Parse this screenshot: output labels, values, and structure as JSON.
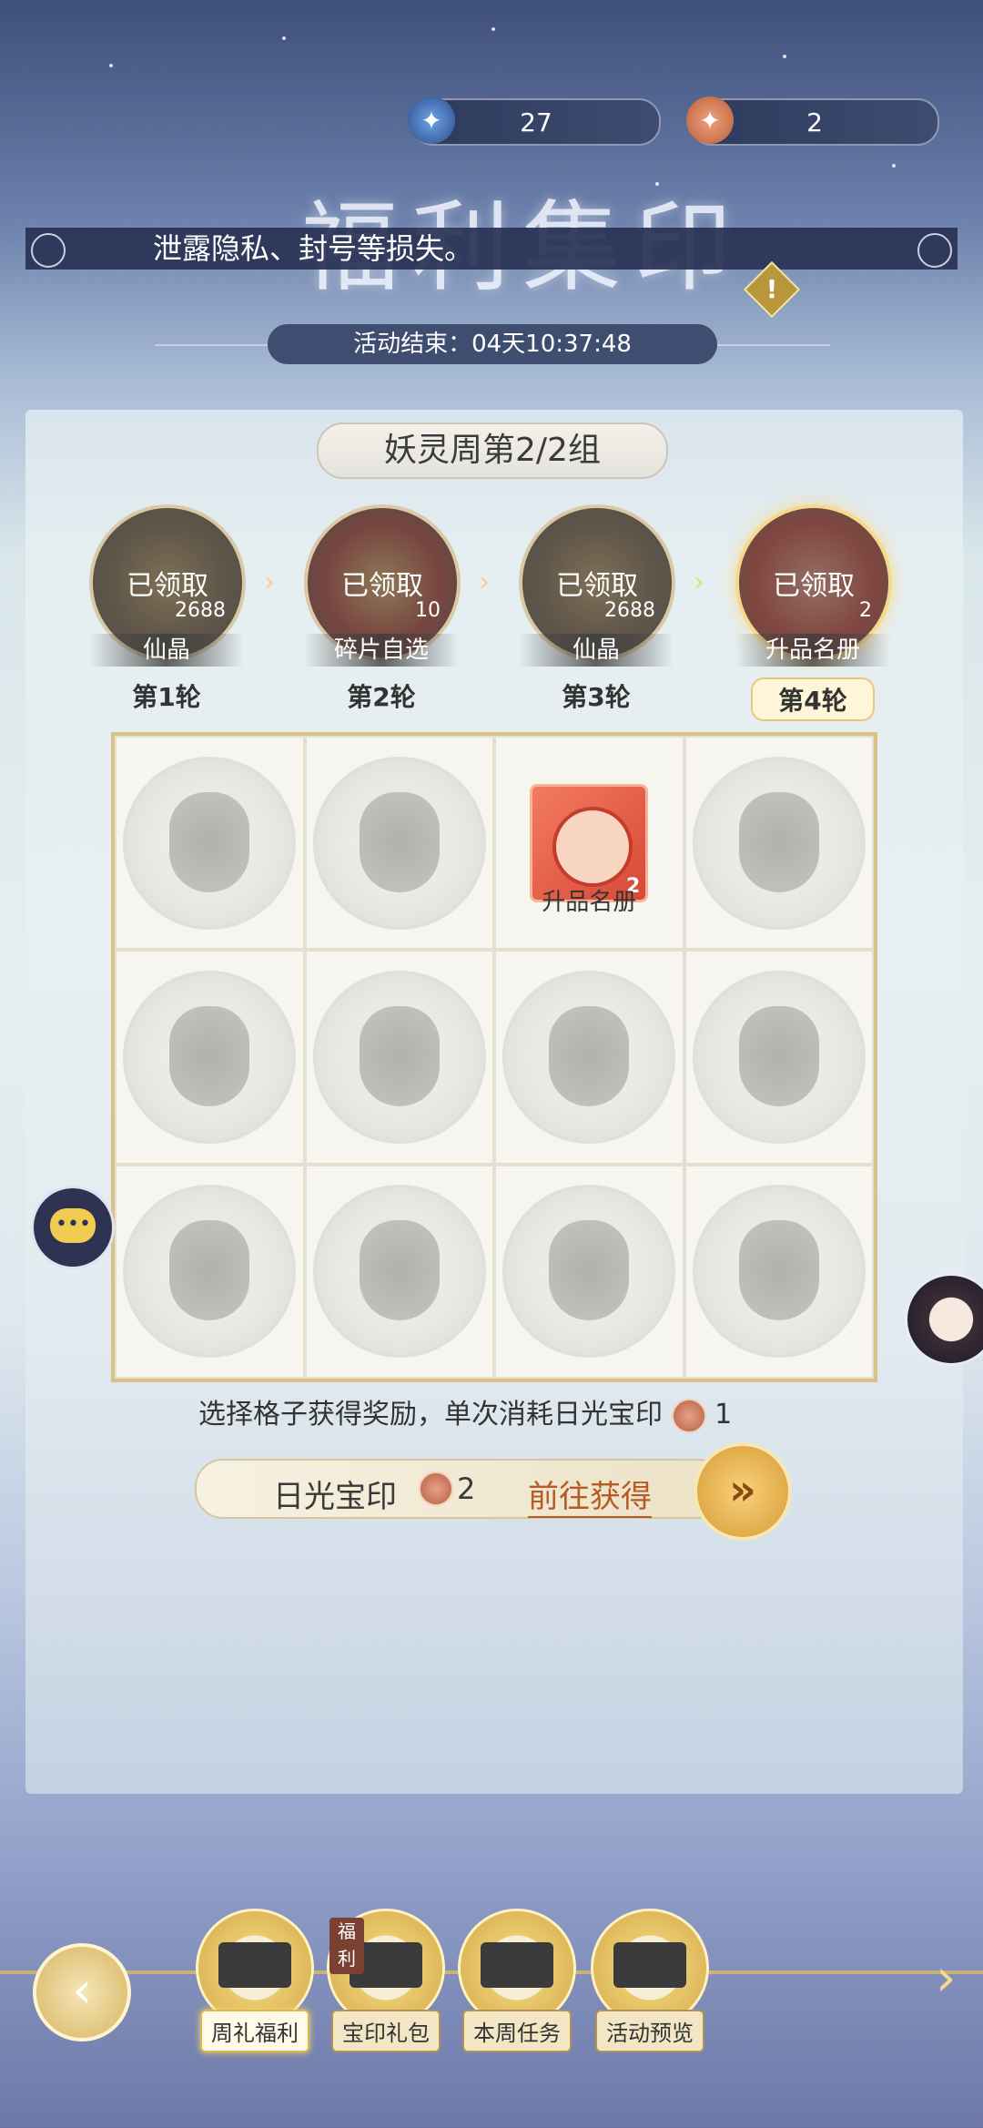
{
  "currency": {
    "blue_count": "27",
    "orange_count": "2",
    "blue_icon": "blue-seal-coin-icon",
    "orange_icon": "sun-seal-coin-icon"
  },
  "header": {
    "title": "福利集印",
    "notice": "泄露隐私、封号等损失。",
    "timer": "活动结束：04天10:37:48"
  },
  "group": {
    "title": "妖灵周第2/2组"
  },
  "rounds": [
    {
      "status": "已领取",
      "qty": "2688",
      "name": "仙晶",
      "label": "第1轮"
    },
    {
      "status": "已领取",
      "qty": "10",
      "name": "碎片自选",
      "label": "第2轮"
    },
    {
      "status": "已领取",
      "qty": "2688",
      "name": "仙晶",
      "label": "第3轮"
    },
    {
      "status": "已领取",
      "qty": "2",
      "name": "升品名册",
      "label": "第4轮"
    }
  ],
  "grid": {
    "revealed": {
      "name": "升品名册",
      "qty": "2"
    }
  },
  "hint": {
    "text": "选择格子获得奖励，单次消耗日光宝印",
    "cost": "1"
  },
  "seal_bar": {
    "label": "日光宝印",
    "count": "2",
    "go": "前往获得"
  },
  "tabs": [
    {
      "label": "周礼福利"
    },
    {
      "label": "宝印礼包",
      "badge": "福利"
    },
    {
      "label": "本周任务"
    },
    {
      "label": "活动预览"
    }
  ],
  "colors": {
    "accent_gold": "#d8b461",
    "panel_navy": "#2d3a5c",
    "link_orange": "#b75a24"
  }
}
